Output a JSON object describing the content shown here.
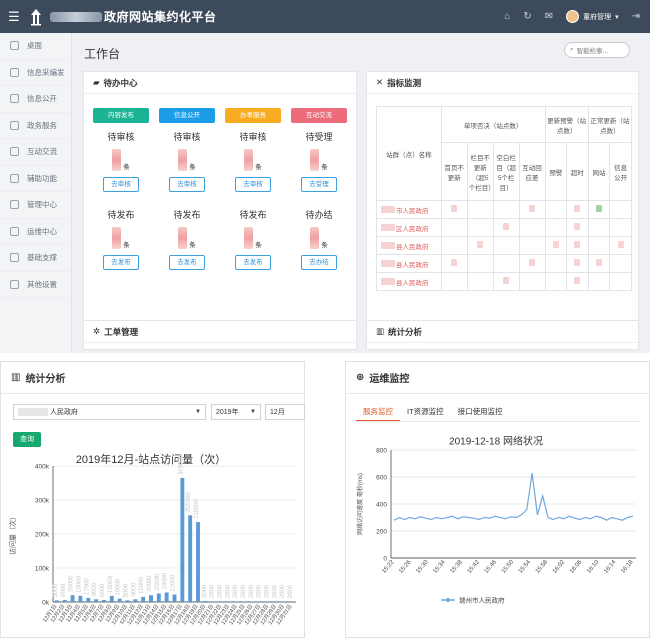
{
  "header": {
    "menu_icon": "hamburger-icon",
    "title": "政府网站集约化平台",
    "user_name": "董府管理",
    "icons": [
      "home-icon",
      "refresh-icon",
      "mail-icon",
      "logout-icon"
    ]
  },
  "sidebar": {
    "items": [
      {
        "label": "桌面",
        "icon": "desktop-icon"
      },
      {
        "label": "信息采编发",
        "icon": "grid-icon"
      },
      {
        "label": "信息公开",
        "icon": "document-icon"
      },
      {
        "label": "政务服务",
        "icon": "briefcase-icon"
      },
      {
        "label": "互动交流",
        "icon": "chat-icon"
      },
      {
        "label": "辅助功能",
        "icon": "gear-icon"
      },
      {
        "label": "管理中心",
        "icon": "settings-icon"
      },
      {
        "label": "运维中心",
        "icon": "chart-icon"
      },
      {
        "label": "基础支撑",
        "icon": "wrench-icon"
      },
      {
        "label": "其他设置",
        "icon": "file-icon"
      }
    ]
  },
  "workspace": {
    "title": "工作台",
    "search_placeholder": "智能检索...",
    "todo": {
      "title": "待办中心",
      "columns": [
        {
          "tag": "内容发布",
          "tag_color": "#1ab394",
          "state1": "待审核",
          "unit1": "条",
          "btn1": "去审核",
          "state2": "待发布",
          "unit2": "条",
          "btn2": "去发布"
        },
        {
          "tag": "信息公开",
          "tag_color": "#1c9ce8",
          "state1": "待审核",
          "unit1": "条",
          "btn1": "去审核",
          "state2": "待发布",
          "unit2": "条",
          "btn2": "去发布"
        },
        {
          "tag": "办事服务",
          "tag_color": "#f8ac21",
          "state1": "待审核",
          "unit1": "条",
          "btn1": "去审核",
          "state2": "待发布",
          "unit2": "条",
          "btn2": "去发布"
        },
        {
          "tag": "互动交流",
          "tag_color": "#ed6c7c",
          "state1": "待受理",
          "unit1": "条",
          "btn1": "去受理",
          "state2": "待办结",
          "unit2": "条",
          "btn2": "去办结"
        }
      ]
    },
    "monitor": {
      "title": "指标监测",
      "col_site": "站群（点）名称",
      "group1": "单项否决（站点数）",
      "group2": "更新预警（站点数）",
      "group3": "正常更新（站点数）",
      "sub": [
        "首页不更新",
        "栏目不更新（超5个栏目）",
        "空白栏目（超5个栏目）",
        "互动回应差",
        "预警",
        "超时",
        "网站",
        "信息公开"
      ],
      "rows": [
        "市人民政府",
        "区人民政府",
        "县人民政府",
        "县人民政府",
        "县人民政府"
      ]
    },
    "work_order": {
      "title": "工单管理"
    },
    "stats": {
      "title": "统计分析"
    }
  },
  "stats_panel": {
    "title": "统计分析",
    "site_select": "人民政府",
    "year_select": "2019年",
    "month_select": "12月",
    "query_label": "查询"
  },
  "ops_panel": {
    "title": "运维监控",
    "tabs": [
      "服务监控",
      "IT资源监控",
      "接口使用监控"
    ],
    "active_tab": 0
  },
  "chart_data": [
    {
      "type": "bar",
      "title": "2019年12月-站点访问量（次）",
      "ylabel": "访问量（次）",
      "ylim": [
        0,
        400000
      ],
      "yticks": [
        "0k",
        "100k",
        "200k",
        "300k",
        "400k"
      ],
      "color": "#5b9bd5",
      "categories": [
        "12月1日",
        "12月2日",
        "12月3日",
        "12月4日",
        "12月5日",
        "12月6日",
        "12月7日",
        "12月8日",
        "12月9日",
        "12月10日",
        "12月11日",
        "12月12日",
        "12月13日",
        "12月14日",
        "12月15日",
        "12月16日",
        "12月17日",
        "12月18日",
        "12月19日",
        "12月20日",
        "12月21日",
        "12月22日",
        "12月23日",
        "12月24日",
        "12月25日",
        "12月26日",
        "12月27日",
        "12月28日",
        "12月29日",
        "12月30日",
        "12月31日"
      ],
      "values": [
        5000,
        6000,
        20000,
        18000,
        12000,
        8000,
        6000,
        18000,
        10000,
        5000,
        8000,
        15000,
        20000,
        25000,
        28000,
        22000,
        365000,
        255000,
        235000,
        3000,
        2000,
        2000,
        2000,
        2000,
        2000,
        2000,
        2000,
        2000,
        2000,
        2000,
        2000
      ]
    },
    {
      "type": "line",
      "title": "2019-12-18 网络状况",
      "ylabel": "网络访问速度 毫秒(ms)",
      "ylim": [
        0,
        800
      ],
      "yticks": [
        "0",
        "200",
        "400",
        "600",
        "800"
      ],
      "color": "#6fa8e0",
      "x": [
        "15:22",
        "15:26",
        "15:30",
        "15:34",
        "15:38",
        "15:42",
        "15:46",
        "15:50",
        "15:54",
        "15:58",
        "16:02",
        "16:06",
        "16:10",
        "16:14",
        "16:18"
      ],
      "values": [
        280,
        300,
        285,
        300,
        290,
        305,
        295,
        285,
        300,
        290,
        300,
        310,
        290,
        305,
        300,
        295,
        285,
        300,
        295,
        310,
        300,
        290,
        305,
        300,
        320,
        360,
        630,
        320,
        460,
        300,
        285,
        300,
        290,
        310,
        295,
        285,
        300,
        290,
        310,
        300,
        280,
        300,
        290,
        280,
        300,
        310
      ],
      "legend": "瑞州市人民政府"
    }
  ]
}
